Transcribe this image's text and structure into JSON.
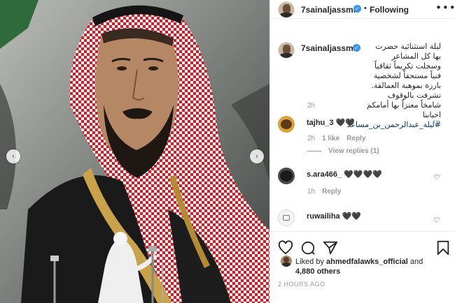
{
  "post": {
    "username": "7sainaljassmi",
    "follow_label": "Following",
    "more_label": "•••",
    "dot": "•",
    "verified_mark": "✓",
    "caption_rtl": "ليلة استثنائية حضرت بها كل المشاعر وسجلت تكريماً ثقافياً فنياً مستحقاً لشخصية بارزة بموهبة العمالقة. تشرفت بالوقوف شامخاً معتزاً بها أمامكم احبابنا",
    "caption_hashtag": "#ليلة_عبدالرحمن_بن_مساعد",
    "caption_time": "2h",
    "nav_left": "‹",
    "nav_right": "›"
  },
  "comments": [
    {
      "user": "tajhu_3",
      "text": "🖤🖤",
      "time": "2h",
      "likes": "1 like",
      "reply": "Reply",
      "view_replies": "View replies (1)"
    },
    {
      "user": "s.ara466_",
      "text": "🖤🖤🖤🖤",
      "time": "1h",
      "reply": "Reply"
    },
    {
      "user": "ruwailiha",
      "text": "🖤🖤"
    }
  ],
  "heart_glyph": "♡",
  "likes": {
    "prefix": "Liked by ",
    "user": "ahmedfalawks_official",
    "and": " and",
    "others": "4,880 others"
  },
  "posted": "2 HOURS AGO",
  "icons": [
    "heart-icon",
    "comment-icon",
    "share-icon",
    "bookmark-icon"
  ]
}
